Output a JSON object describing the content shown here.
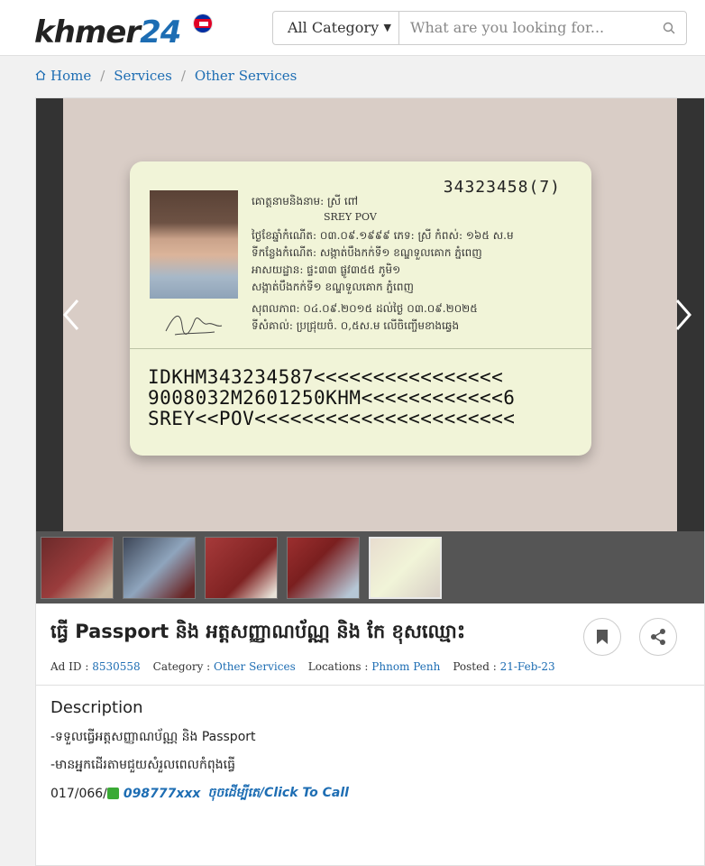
{
  "header": {
    "logo_text": "khmer",
    "logo_num": "24",
    "category_select": "All Category",
    "search_placeholder": "What are you looking for..."
  },
  "breadcrumb": [
    "Home",
    "Services",
    "Other Services"
  ],
  "id_card": {
    "number": "34323458(7)",
    "name_kh": "គោត្តនាមនិងនាម: ស្រី ពៅ",
    "name_en": "SREY POV",
    "dob": "ថ្ងៃខែឆ្នាំកំណើត: ០៣.០៩.១៩៩៩   ភេទ: ស្រី   កំពស់: ១៦៥ ស.ម",
    "birthplace": "ទីកន្លែងកំណើត: សង្កាត់បឹងកក់ទី១ ខណ្ឌទួលគោក ភ្នំពេញ",
    "address": "អាសយដ្ឋាន: ផ្ទះ៣៣ ផ្លូវ៣៥៥ ភូមិ១",
    "address2": "សង្កាត់បឹងកក់ទី១ ខណ្ឌទួលគោក ភ្នំពេញ",
    "validity": "សុពលភាព: ០៤.០៩.២០១៥ ដល់ថ្ងៃ ០៣.០៩.២០២៥",
    "marks": "ទីសំគាល់: ប្រជ្រុយចំ. ០,៥ស.ម លើចិញ្ចើមខាងឆ្វេង",
    "mrz": [
      "IDKHM343234587<<<<<<<<<<<<<<<<",
      "9008032M2601250KHM<<<<<<<<<<<<6",
      "SREY<<POV<<<<<<<<<<<<<<<<<<<<<<"
    ]
  },
  "listing": {
    "title": "ធ្វើ Passport និង អត្តសញ្ញាណប័ណ្ណ និង កែ ខុសឈ្មោះ",
    "ad_id_label": "Ad ID :",
    "ad_id": "8530558",
    "category_label": "Category :",
    "category": "Other Services",
    "location_label": "Locations :",
    "location": "Phnom Penh",
    "posted_label": "Posted :",
    "posted": "21-Feb-23"
  },
  "description": {
    "heading": "Description",
    "line1": "-ទទួលធ្វើអត្តសញ្ញាណប័ណ្ណ និង Passport",
    "line2": "-មានអ្នកដើរតាមជួយសំរួលពេលកំពុងធ្វើ",
    "phone_prefix": "017/066/",
    "phone_num": "098777xxx",
    "call_text": "ចុចដើម្បីតេ/Click To Call"
  },
  "colors": {
    "link": "#1d6db3",
    "brand": "#1d6db3"
  }
}
